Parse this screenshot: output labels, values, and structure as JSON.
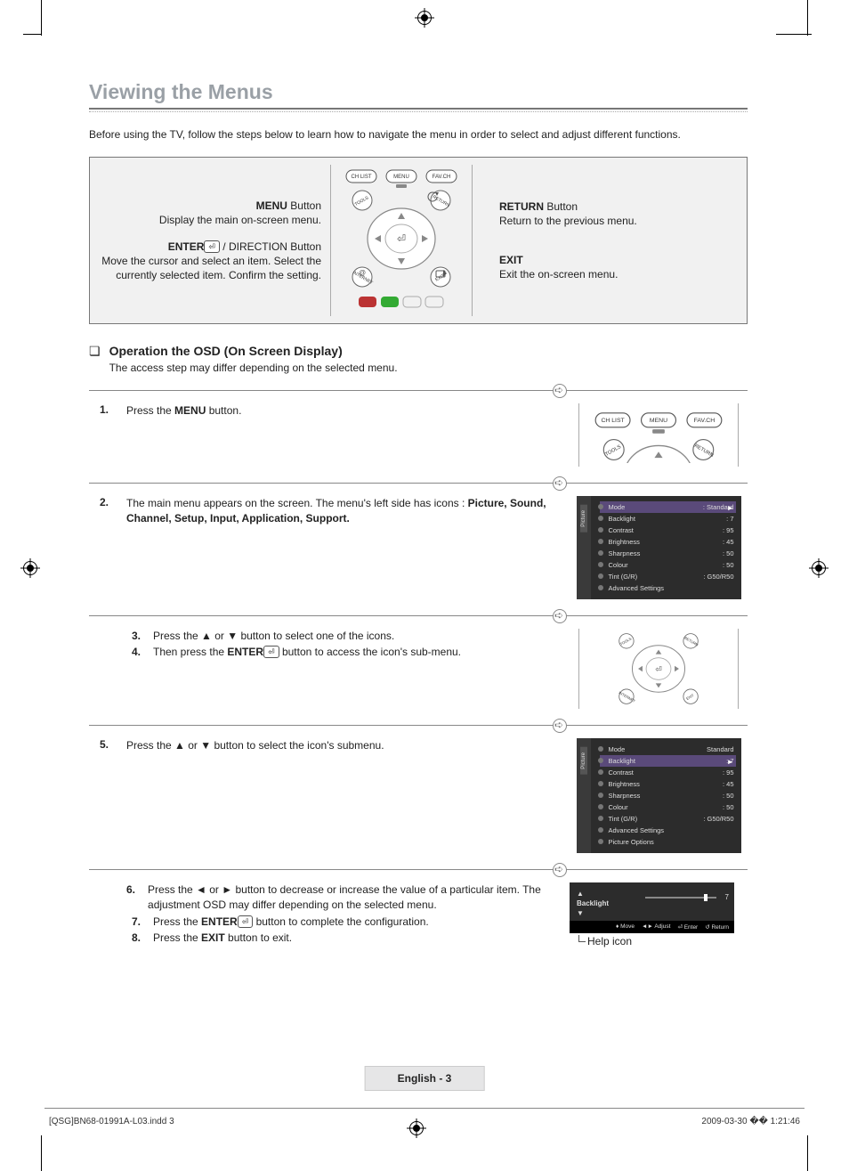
{
  "title": "Viewing the Menus",
  "intro": "Before using the TV, follow the steps below to learn how to navigate the menu in order to select and adjust different functions.",
  "remote": {
    "top_buttons": [
      "CH LIST",
      "MENU",
      "FAV.CH"
    ],
    "corner_buttons": [
      "TOOLS",
      "RETURN",
      "INTERNET",
      "EXIT"
    ],
    "left_menu_bold": "MENU",
    "left_menu_tail": " Button",
    "left_menu_desc": "Display the main on-screen menu.",
    "left_enter_bold": "ENTER",
    "left_enter_tail": " / DIRECTION Button",
    "left_enter_desc": "Move the cursor and select an item. Select the currently selected item. Confirm the setting.",
    "right_return_bold": "RETURN",
    "right_return_tail": " Button",
    "right_return_desc": "Return to the previous menu.",
    "right_exit_bold": "EXIT",
    "right_exit_desc": "Exit the on-screen menu."
  },
  "osd": {
    "mark": "❏",
    "heading": "Operation the OSD (On Screen Display)",
    "sub": "The access step may differ depending on the selected menu."
  },
  "steps": {
    "s1": {
      "num": "1.",
      "pre": "Press the ",
      "bold": "MENU",
      "post": " button."
    },
    "s2": {
      "num": "2.",
      "pre": "The main menu appears on the screen. The menu's left side has icons : ",
      "bold": "Picture, Sound, Channel, Setup, Input, Application, Support."
    },
    "s3": {
      "num": "3.",
      "text": "Press the ▲ or ▼ button to select one of the icons."
    },
    "s4": {
      "num": "4.",
      "pre": "Then press the ",
      "bold": "ENTER",
      "post": " button to access the icon's sub-menu."
    },
    "s5": {
      "num": "5.",
      "text": "Press the ▲ or ▼ button to select the icon's submenu."
    },
    "s6": {
      "num": "6.",
      "text": "Press the ◄ or ► button to decrease or increase the value of a particular item. The adjustment OSD may differ depending on the selected menu."
    },
    "s7": {
      "num": "7.",
      "pre": "Press the ",
      "bold": "ENTER",
      "post": " button to complete the configuration."
    },
    "s8": {
      "num": "8.",
      "pre": "Press the ",
      "bold": "EXIT",
      "post": " button to exit."
    }
  },
  "menu_screen": {
    "side_label": "Picture",
    "rows": [
      {
        "label": "Mode",
        "value": ": Standard",
        "sel": true,
        "arrow": true
      },
      {
        "label": "Backlight",
        "value": ": 7"
      },
      {
        "label": "Contrast",
        "value": ": 95"
      },
      {
        "label": "Brightness",
        "value": ": 45"
      },
      {
        "label": "Sharpness",
        "value": ": 50"
      },
      {
        "label": "Colour",
        "value": ": 50"
      },
      {
        "label": "Tint (G/R)",
        "value": ": G50/R50"
      },
      {
        "label": "Advanced Settings",
        "value": ""
      }
    ]
  },
  "submenu_screen": {
    "side_label": "Picture",
    "rows": [
      {
        "label": "Mode",
        "value": "Standard"
      },
      {
        "label": "Backlight",
        "value": ": 7",
        "sel": true,
        "arrow": true
      },
      {
        "label": "Contrast",
        "value": ": 95"
      },
      {
        "label": "Brightness",
        "value": ": 45"
      },
      {
        "label": "Sharpness",
        "value": ": 50"
      },
      {
        "label": "Colour",
        "value": ": 50"
      },
      {
        "label": "Tint (G/R)",
        "value": ": G50/R50"
      },
      {
        "label": "Advanced Settings",
        "value": ""
      },
      {
        "label": "Picture Options",
        "value": ""
      }
    ]
  },
  "adjust": {
    "label_top": "▲",
    "label": "Backlight",
    "label_bottom": "▼",
    "value": "7",
    "bar": [
      "♦ Move",
      "◄► Adjust",
      "⏎ Enter",
      "↺ Return"
    ],
    "help": "Help icon"
  },
  "enter_glyph": "⏎",
  "footer": {
    "page": "English - 3",
    "left": "[QSG]BN68-01991A-L03.indd   3",
    "right": "2009-03-30   �� 1:21:46"
  }
}
